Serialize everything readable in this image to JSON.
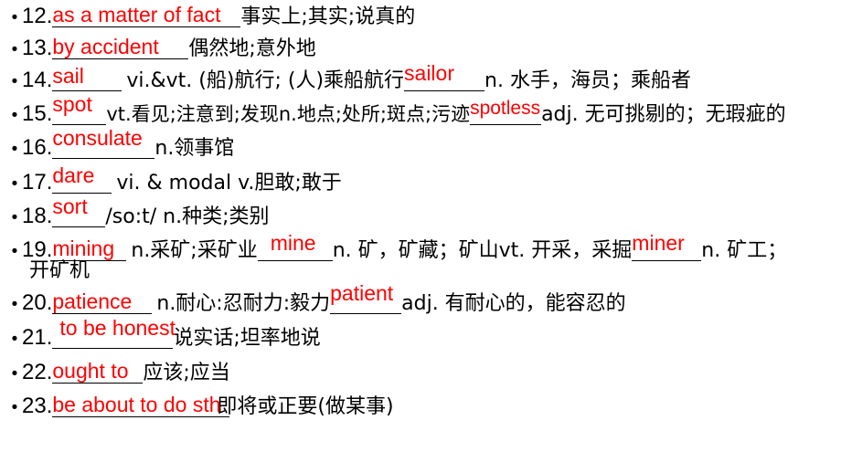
{
  "slide": {
    "background_color": "#FFFFFF",
    "answer_color": "#FF0000",
    "text_color": "#000000",
    "type": "vocabulary-fill-in-the-blank-list",
    "items": [
      {
        "number": "12.",
        "answer": " as a matter of fact",
        "definition": "事实上;其实;说真的",
        "answer2": "",
        "definition2": ""
      },
      {
        "number": "13.",
        "answer": "  by accident",
        "definition": "偶然地;意外地",
        "answer2": "",
        "definition2": ""
      },
      {
        "number": "14.",
        "answer": "  sail",
        "definition": "vi.&vt. (船)航行; (人)乘船航行",
        "answer2": "sailor",
        "definition2": "n. 水手，海员；乘船者"
      },
      {
        "number": "15.",
        "answer": "spot",
        "definition": "vt.看见;注意到;发现n.地点;处所;斑点;污迹",
        "answer2": "spotless",
        "definition2": "adj. 无可挑剔的；无瑕疵的"
      },
      {
        "number": "16.",
        "answer": "consulate",
        "definition": "n.领事馆",
        "answer2": "",
        "definition2": ""
      },
      {
        "number": "17.",
        "answer": "dare",
        "definition": "vi. & modal v.胆敢;敢于",
        "answer2": "",
        "definition2": ""
      },
      {
        "number": "18.",
        "answer": "sort",
        "definition": "/so:t/ n.种类;类别",
        "answer2": "",
        "definition2": ""
      },
      {
        "number": "19.",
        "answer": "mining",
        "definition": "n.采矿;采矿业",
        "answer2": "mine",
        "definition2": "n. 矿，矿藏；矿山vt. 开采，采掘",
        "answer3": "miner",
        "definition3": "n. 矿工；",
        "wrapped": "开矿机"
      },
      {
        "number": "20.",
        "answer": " patience",
        "definition": "n.耐心:忍耐力:毅力",
        "answer2": "patient",
        "definition2": "adj. 有耐心的，能容忍的"
      },
      {
        "number": "21.",
        "answer": "to be honest",
        "definition": "说实话;坦率地说",
        "answer2": "",
        "definition2": ""
      },
      {
        "number": "22.",
        "answer": " ought  to",
        "definition": "应该;应当",
        "answer2": "",
        "definition2": ""
      },
      {
        "number": "23.",
        "answer": " be about to do sth",
        "definition": "即将或正要(做某事)",
        "answer2": "",
        "definition2": ""
      }
    ]
  }
}
